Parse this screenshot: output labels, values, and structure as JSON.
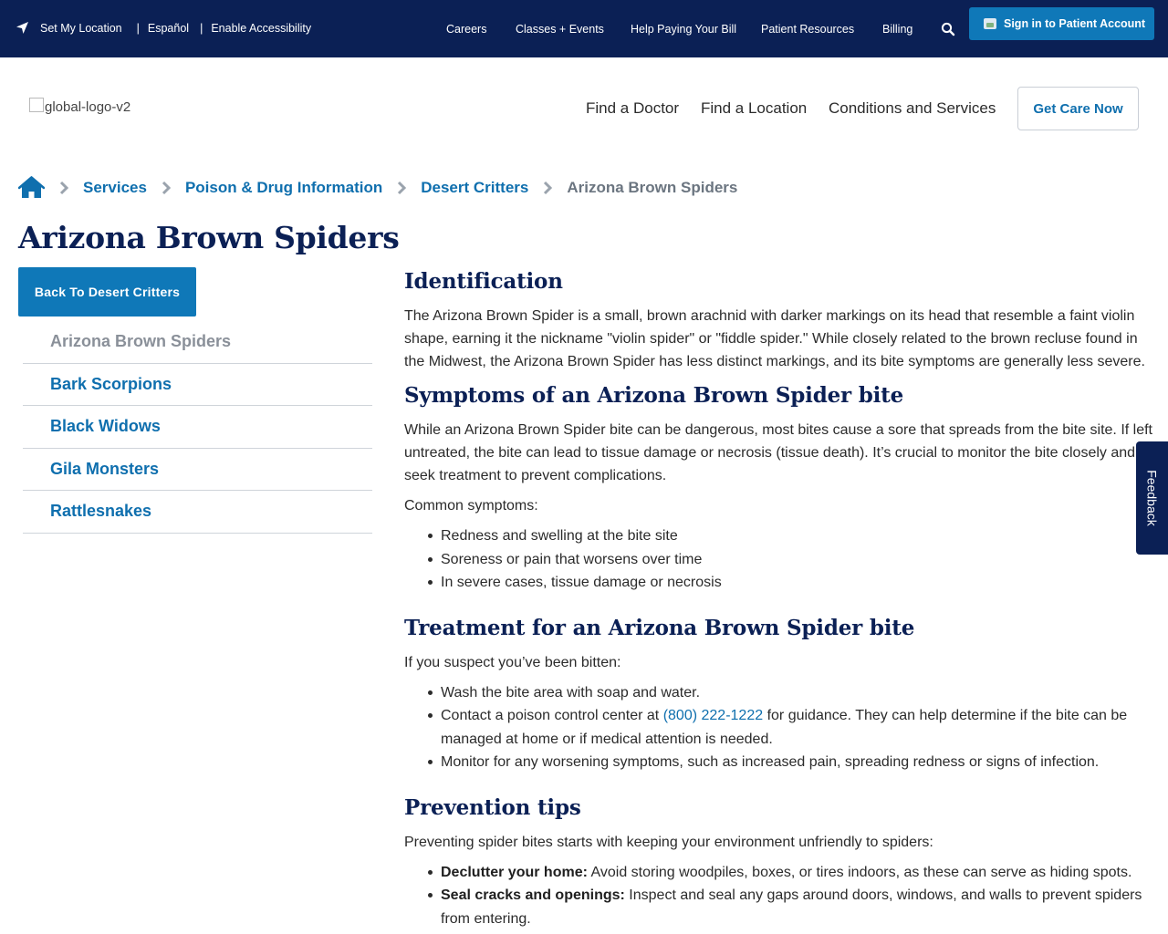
{
  "utility_bar": {
    "set_location": "Set My Location",
    "divider": "|",
    "espanol": "Español",
    "accessibility": "Enable Accessibility",
    "links": [
      "Careers",
      "Classes + Events",
      "Help Paying Your Bill",
      "Patient Resources",
      "Billing"
    ],
    "sign_in": "Sign in to Patient Account",
    "icons": {
      "location": "location-arrow-icon",
      "search": "search-icon",
      "user": "user-image-icon"
    }
  },
  "header": {
    "logo_alt": "global-logo-v2",
    "nav": [
      "Find a Doctor",
      "Find a Location",
      "Conditions and Services"
    ],
    "get_care": "Get Care Now"
  },
  "breadcrumb": {
    "items": [
      "Services",
      "Poison & Drug Information",
      "Desert Critters"
    ],
    "current": "Arizona Brown Spiders"
  },
  "page": {
    "title": "Arizona Brown Spiders"
  },
  "sidebar": {
    "back_label": "Back To Desert Critters",
    "items": [
      "Arizona Brown Spiders",
      "Bark Scorpions",
      "Black Widows",
      "Gila Monsters",
      "Rattlesnakes"
    ],
    "active_index": 0
  },
  "content": {
    "identification": {
      "heading": "Identification",
      "body": "The Arizona Brown Spider is a small, brown arachnid with darker markings on its head that resemble a faint violin shape, earning it the nickname \"violin spider\" or \"fiddle spider.\" While closely related to the brown recluse found in the Midwest, the Arizona Brown Spider has less distinct markings, and its bite symptoms are generally less severe."
    },
    "symptoms": {
      "heading": "Symptoms of an Arizona Brown Spider bite",
      "body": "While an Arizona Brown Spider bite can be dangerous, most bites cause a sore that spreads from the bite site. If left untreated, the bite can lead to tissue damage or necrosis (tissue death). It’s crucial to monitor the bite closely and seek treatment to prevent complications.",
      "intro": "Common symptoms:",
      "items": [
        "Redness and swelling at the bite site",
        "Soreness or pain that worsens over time",
        "In severe cases, tissue damage or necrosis"
      ]
    },
    "treatment": {
      "heading": "Treatment for an Arizona Brown Spider bite",
      "intro": "If you suspect you’ve been bitten:",
      "item1": "Wash the bite area with soap and water.",
      "item2_pre": "Contact a poison control center at ",
      "item2_phone": "(800) 222-1222",
      "item2_post": " for guidance. They can help determine if the bite can be managed at home or if medical attention is needed.",
      "item3": "Monitor for any worsening symptoms, such as increased pain, spreading redness or signs of infection."
    },
    "prevention": {
      "heading": "Prevention tips",
      "intro": "Preventing spider bites starts with keeping your environment unfriendly to spiders:",
      "tips": [
        {
          "bold": "Declutter your home:",
          "text": " Avoid storing woodpiles, boxes, or tires indoors, as these can serve as hiding spots."
        },
        {
          "bold": "Seal cracks and openings:",
          "text": " Inspect and seal any gaps around doors, windows, and walls to prevent spiders from entering."
        }
      ]
    }
  },
  "feedback": "Feedback",
  "colors": {
    "navy": "#0b2055",
    "accent_blue": "#0f78b8",
    "link_blue": "#0f6fae"
  }
}
